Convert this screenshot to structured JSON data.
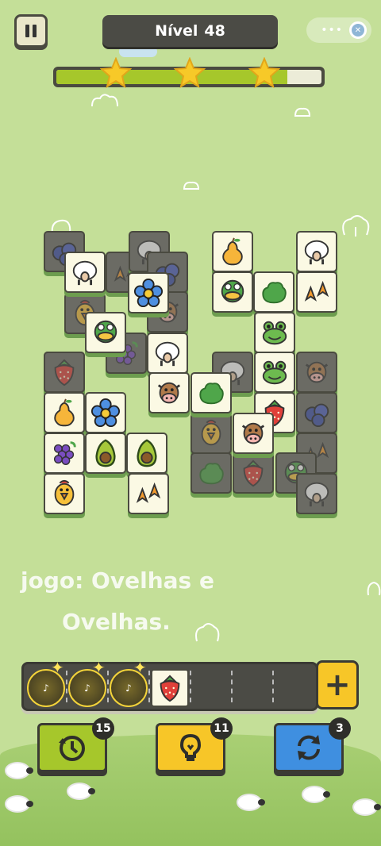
{
  "header": {
    "level_label": "Nível",
    "level_number": "48",
    "toggle_dots": "•••",
    "progress_fraction": 0.87,
    "stars_earned": 3
  },
  "board": {
    "tiles": [
      {
        "icon": "blueberry",
        "dim": true
      },
      {
        "icon": "sheep",
        "dim": false
      },
      {
        "icon": "duck-feet",
        "dim": true
      },
      {
        "icon": "sheep",
        "dim": true
      },
      {
        "icon": "blueberry",
        "dim": true
      },
      {
        "icon": "flower",
        "dim": false
      },
      {
        "icon": "cow",
        "dim": true
      },
      {
        "icon": "chicken",
        "dim": true
      },
      {
        "icon": "duck",
        "dim": false
      },
      {
        "icon": "strawberry",
        "dim": true
      },
      {
        "icon": "grape",
        "dim": true
      },
      {
        "icon": "sheep",
        "dim": false
      },
      {
        "icon": "strawberry",
        "dim": true
      },
      {
        "icon": "pear",
        "dim": false
      },
      {
        "icon": "flower",
        "dim": false
      },
      {
        "icon": "cow",
        "dim": false
      },
      {
        "icon": "lettuce",
        "dim": false
      },
      {
        "icon": "grape",
        "dim": false
      },
      {
        "icon": "avocado",
        "dim": false
      },
      {
        "icon": "avocado",
        "dim": false
      },
      {
        "icon": "chicken",
        "dim": false
      },
      {
        "icon": "duck-feet",
        "dim": false
      },
      {
        "icon": "pear",
        "dim": false
      },
      {
        "icon": "sheep",
        "dim": false
      },
      {
        "icon": "duck",
        "dim": false
      },
      {
        "icon": "lettuce",
        "dim": false
      },
      {
        "icon": "duck-feet",
        "dim": false
      },
      {
        "icon": "frog",
        "dim": false
      },
      {
        "icon": "sheep",
        "dim": true
      },
      {
        "icon": "cow",
        "dim": true
      },
      {
        "icon": "frog",
        "dim": false
      },
      {
        "icon": "strawberry",
        "dim": false
      },
      {
        "icon": "blueberry",
        "dim": true
      },
      {
        "icon": "chicken",
        "dim": true
      },
      {
        "icon": "cow",
        "dim": false
      },
      {
        "icon": "duck-feet",
        "dim": true
      },
      {
        "icon": "lettuce",
        "dim": true
      },
      {
        "icon": "strawberry",
        "dim": true
      },
      {
        "icon": "duck",
        "dim": true
      },
      {
        "icon": "sheep",
        "dim": true
      }
    ]
  },
  "caption": {
    "line1": "jogo: Ovelhas e",
    "line2": "Ovelhas."
  },
  "tray": {
    "slot_count": 7,
    "slots": [
      "sparkle",
      "sparkle",
      "sparkle",
      "strawberry",
      "",
      "",
      ""
    ],
    "add_label": "+"
  },
  "powerups": [
    {
      "name": "undo",
      "count": "15",
      "color": "#a6c72b"
    },
    {
      "name": "hint",
      "count": "11",
      "color": "#f7c628"
    },
    {
      "name": "shuffle",
      "count": "3",
      "color": "#3f8fe0"
    }
  ],
  "colors": {
    "background": "#c4df98",
    "tile": "#fbf9e4",
    "dim_tile": "#6b6b64",
    "dark": "#4a4a40"
  }
}
